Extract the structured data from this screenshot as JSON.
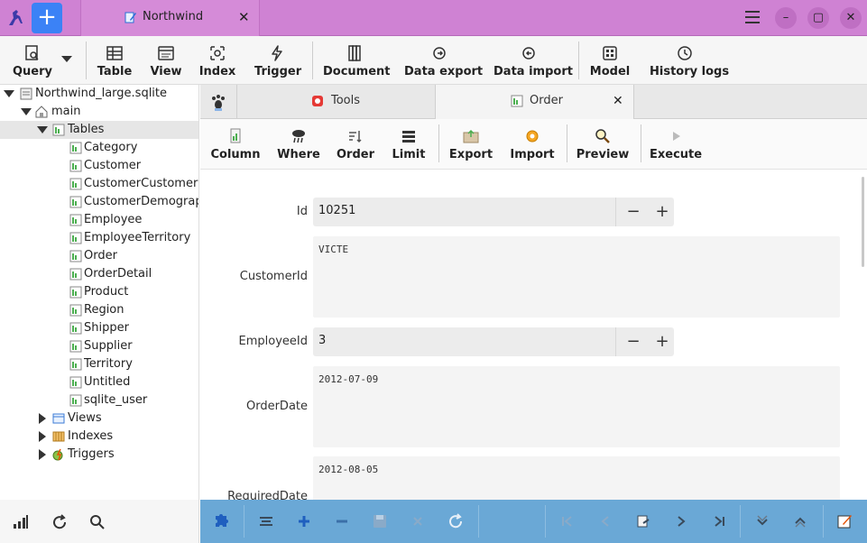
{
  "window": {
    "tab_title": "Northwind",
    "tab_close": "✕",
    "new_button": "+",
    "minimize": "–",
    "maximize": "▢",
    "close": "✕"
  },
  "toolbar": {
    "query": "Query",
    "table": "Table",
    "view": "View",
    "index": "Index",
    "trigger": "Trigger",
    "document": "Document",
    "data_export": "Data export",
    "data_import": "Data import",
    "model": "Model",
    "history_logs": "History logs"
  },
  "tree": {
    "database": "Northwind_large.sqlite",
    "schema": "main",
    "tables_label": "Tables",
    "tables": [
      "Category",
      "Customer",
      "CustomerCustomerDe",
      "CustomerDemographi",
      "Employee",
      "EmployeeTerritory",
      "Order",
      "OrderDetail",
      "Product",
      "Region",
      "Shipper",
      "Supplier",
      "Territory",
      "Untitled",
      "sqlite_user"
    ],
    "views_label": "Views",
    "indexes_label": "Indexes",
    "triggers_label": "Triggers"
  },
  "tabs2": {
    "tools": "Tools",
    "order": "Order",
    "close": "✕"
  },
  "toolbar2": {
    "column": "Column",
    "where": "Where",
    "order": "Order",
    "limit": "Limit",
    "export": "Export",
    "import": "Import",
    "preview": "Preview",
    "execute": "Execute"
  },
  "form": {
    "id_label": "Id",
    "id_value": "10251",
    "customerid_label": "CustomerId",
    "customerid_value": "VICTE",
    "employeeid_label": "EmployeeId",
    "employeeid_value": "3",
    "orderdate_label": "OrderDate",
    "orderdate_value": "2012-07-09",
    "requireddate_label": "RequiredDate",
    "requireddate_value": "2012-08-05",
    "minus": "−",
    "plus": "+"
  },
  "colors": {
    "titlebar": "#cf82d3",
    "accent_blue": "#3b82f6",
    "bottombar": "#6aa8d6"
  }
}
